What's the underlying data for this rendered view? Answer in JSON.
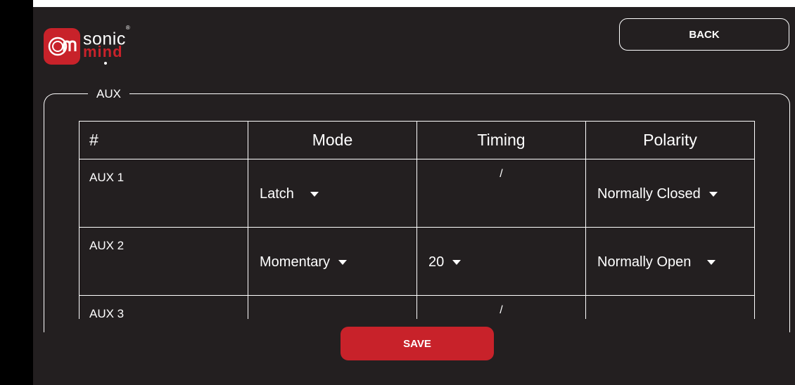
{
  "brand": {
    "logo_mark": "sm",
    "name_top": "sonic",
    "registered": "®",
    "name_bottom": "mind",
    "accent": "#c8222a"
  },
  "header": {
    "back_label": "BACK"
  },
  "aux_section": {
    "title": "AUX",
    "columns": [
      "#",
      "Mode",
      "Timing",
      "Polarity"
    ],
    "rows": [
      {
        "label": "AUX 1",
        "mode": "Latch",
        "timing": "/",
        "polarity": "Normally Closed"
      },
      {
        "label": "AUX 2",
        "mode": "Momentary",
        "timing": "20",
        "polarity": "Normally Open"
      },
      {
        "label": "AUX 3",
        "mode": "",
        "timing": "/",
        "polarity": ""
      }
    ]
  },
  "footer": {
    "save_label": "SAVE"
  },
  "colors": {
    "background": "#231f20",
    "accent": "#c8222a",
    "text": "#ffffff"
  }
}
